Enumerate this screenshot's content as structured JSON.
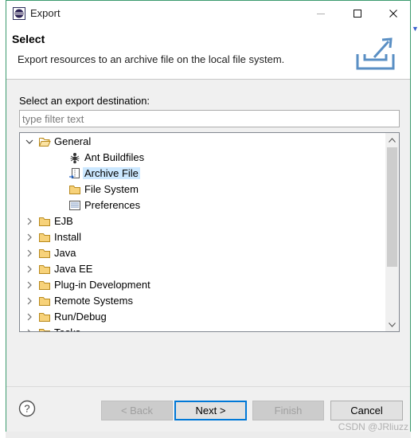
{
  "window": {
    "title": "Export"
  },
  "header": {
    "title": "Select",
    "description": "Export resources to an archive file on the local file system."
  },
  "destination_label": "Select an export destination:",
  "filter": {
    "placeholder": "type filter text",
    "value": ""
  },
  "tree": {
    "items": [
      {
        "label": "General",
        "icon": "folder-open-icon",
        "expanded": true,
        "level": 0
      },
      {
        "label": "Ant Buildfiles",
        "icon": "ant-icon",
        "level": 1
      },
      {
        "label": "Archive File",
        "icon": "archive-file-icon",
        "level": 1,
        "selected": true
      },
      {
        "label": "File System",
        "icon": "folder-icon",
        "level": 1
      },
      {
        "label": "Preferences",
        "icon": "preferences-icon",
        "level": 1
      },
      {
        "label": "EJB",
        "icon": "folder-icon",
        "expanded": false,
        "level": 0
      },
      {
        "label": "Install",
        "icon": "folder-icon",
        "expanded": false,
        "level": 0
      },
      {
        "label": "Java",
        "icon": "folder-icon",
        "expanded": false,
        "level": 0
      },
      {
        "label": "Java EE",
        "icon": "folder-icon",
        "expanded": false,
        "level": 0
      },
      {
        "label": "Plug-in Development",
        "icon": "folder-icon",
        "expanded": false,
        "level": 0
      },
      {
        "label": "Remote Systems",
        "icon": "folder-icon",
        "expanded": false,
        "level": 0
      },
      {
        "label": "Run/Debug",
        "icon": "folder-icon",
        "expanded": false,
        "level": 0
      },
      {
        "label": "Tasks",
        "icon": "folder-icon",
        "expanded": false,
        "level": 0
      }
    ]
  },
  "buttons": {
    "back": "< Back",
    "next": "Next >",
    "finish": "Finish",
    "cancel": "Cancel"
  },
  "watermark": "CSDN @JRliuzz",
  "colors": {
    "accent": "#0078d7",
    "selection": "#cce8ff",
    "window_border": "#3c9a6e"
  }
}
